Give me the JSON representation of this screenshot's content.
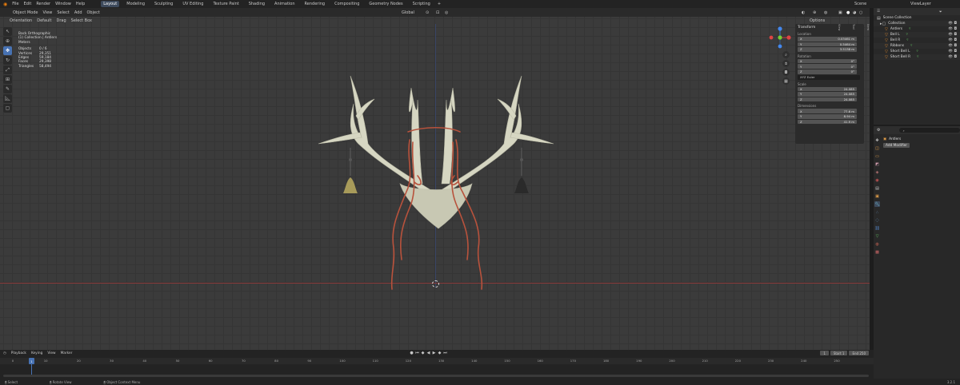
{
  "menu": {
    "items": [
      "File",
      "Edit",
      "Render",
      "Window",
      "Help"
    ],
    "workspaces": [
      "Layout",
      "Modeling",
      "Sculpting",
      "UV Editing",
      "Texture Paint",
      "Shading",
      "Animation",
      "Rendering",
      "Compositing",
      "Geometry Nodes",
      "Scripting"
    ],
    "active_workspace": "Layout",
    "scene": "Scene",
    "view_layer": "ViewLayer"
  },
  "viewport": {
    "mode": "Object Mode",
    "menus": [
      "View",
      "Select",
      "Add",
      "Object"
    ],
    "orientation": "Orientation",
    "orientation_value": "Default",
    "drag": "Drag",
    "select_box": "Select Box",
    "transform_space": "Global",
    "options": "Options"
  },
  "stats": {
    "view_name": "Back Orthographic",
    "collection": "(1) Collection | Antlers",
    "units": "Meters",
    "rows": [
      {
        "label": "Objects",
        "value": "0 / 6"
      },
      {
        "label": "Vertices",
        "value": "29,351"
      },
      {
        "label": "Edges",
        "value": "59,184"
      },
      {
        "label": "Faces",
        "value": "29,398"
      },
      {
        "label": "Triangles",
        "value": "58,494"
      }
    ]
  },
  "npanel": {
    "title": "Transform",
    "location_label": "Location",
    "location": [
      {
        "axis": "X",
        "value": "0.03461 m"
      },
      {
        "axis": "Y",
        "value": "0.5464 m"
      },
      {
        "axis": "Z",
        "value": "3.5138 m"
      }
    ],
    "rotation_label": "Rotation",
    "rotation": [
      {
        "axis": "X",
        "value": "0°"
      },
      {
        "axis": "Y",
        "value": "0°"
      },
      {
        "axis": "Z",
        "value": "0°"
      }
    ],
    "rotation_mode": "XYZ Euler",
    "scale_label": "Scale",
    "scale": [
      {
        "axis": "X",
        "value": "24.085"
      },
      {
        "axis": "Y",
        "value": "24.085"
      },
      {
        "axis": "Z",
        "value": "24.085"
      }
    ],
    "dimensions_label": "Dimensions",
    "dimensions": [
      {
        "axis": "X",
        "value": "77.6 m"
      },
      {
        "axis": "Y",
        "value": "8.94 m"
      },
      {
        "axis": "Z",
        "value": "41.9 m"
      }
    ],
    "tabs": [
      "Item",
      "Tool",
      "View"
    ]
  },
  "outliner": {
    "root": "Scene Collection",
    "collection": "Collection",
    "objects": [
      "Antlers",
      "Bell L",
      "Bell R",
      "Ribbons",
      "Short Bell L",
      "Short Bell R"
    ]
  },
  "properties": {
    "search_placeholder": "",
    "object_name": "Antlers",
    "add_modifier": "Add Modifier"
  },
  "timeline": {
    "menus": [
      "Playback",
      "Keying",
      "View",
      "Marker"
    ],
    "current_frame": "1",
    "start_label": "Start",
    "start": "1",
    "end_label": "End",
    "end": "250",
    "ticks": [
      "0",
      "10",
      "20",
      "30",
      "40",
      "50",
      "60",
      "70",
      "80",
      "90",
      "100",
      "110",
      "120",
      "130",
      "140",
      "150",
      "160",
      "170",
      "180",
      "190",
      "200",
      "210",
      "220",
      "230",
      "240",
      "250"
    ]
  },
  "status": {
    "items": [
      "Select",
      "Rotate View",
      "Object Context Menu"
    ],
    "version": "3.2.1"
  },
  "colors": {
    "accent": "#4772b3",
    "x_axis": "#8a3a3a",
    "antler": "#d8d8c4",
    "ribbon": "#b8523c"
  }
}
